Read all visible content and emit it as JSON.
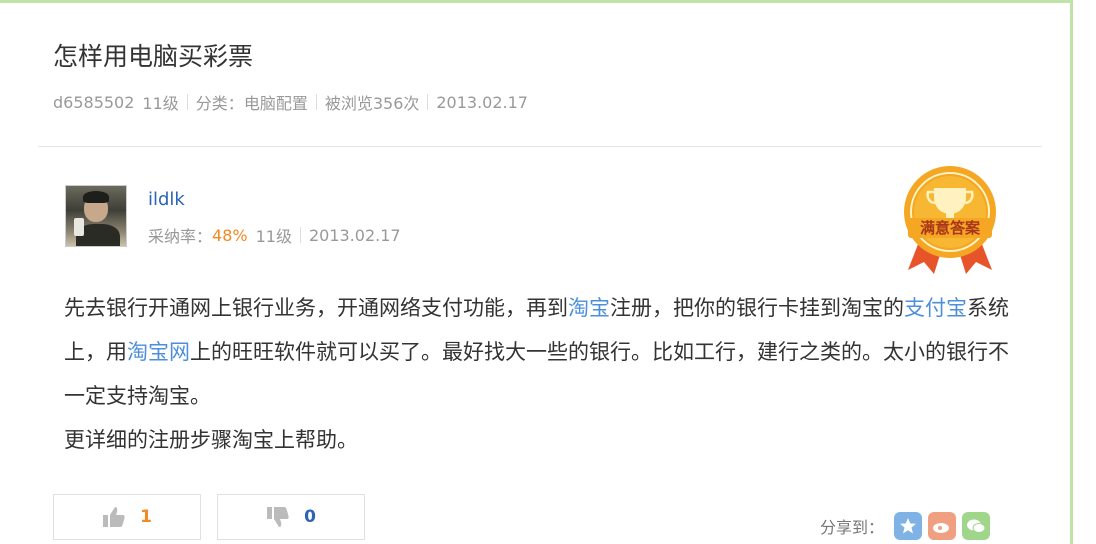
{
  "question": {
    "title": "怎样用电脑买彩票",
    "asker": "d6585502",
    "asker_level": "11级",
    "category_label": "分类：",
    "category": "电脑配置",
    "views": "被浏览356次",
    "date": "2013.02.17"
  },
  "answer": {
    "user": "ildlk",
    "adopt_label": "采纳率：",
    "adopt_rate": "48%",
    "level": "11级",
    "date": "2013.02.17",
    "badge_text": "满意答案",
    "badge_color": "#f5a623",
    "p1_a": "先去银行开通网上银行业务，开通网络支付功能，再到",
    "link_taobao": "淘宝",
    "p1_b": "注册，把你的银行卡挂到淘宝的",
    "link_alipay": "支付宝",
    "p1_c": "系统上，用",
    "link_taobao_net": "淘宝网",
    "p1_d": "上的旺旺软件就可以买了。最好找大一些的银行。比如工行，建行之类的。太小的银行不一定支持淘宝。",
    "p2": "更详细的注册步骤淘宝上帮助。"
  },
  "votes": {
    "up_icon": "thumbs-up-icon",
    "up_count": "1",
    "down_icon": "thumbs-down-icon",
    "down_count": "0"
  },
  "share": {
    "label": "分享到：",
    "icons": [
      "qzone-icon",
      "weibo-icon",
      "wechat-icon"
    ]
  },
  "colors": {
    "link": "#2d64b3",
    "accent": "#f08a24",
    "frame": "#bfe3a8"
  }
}
